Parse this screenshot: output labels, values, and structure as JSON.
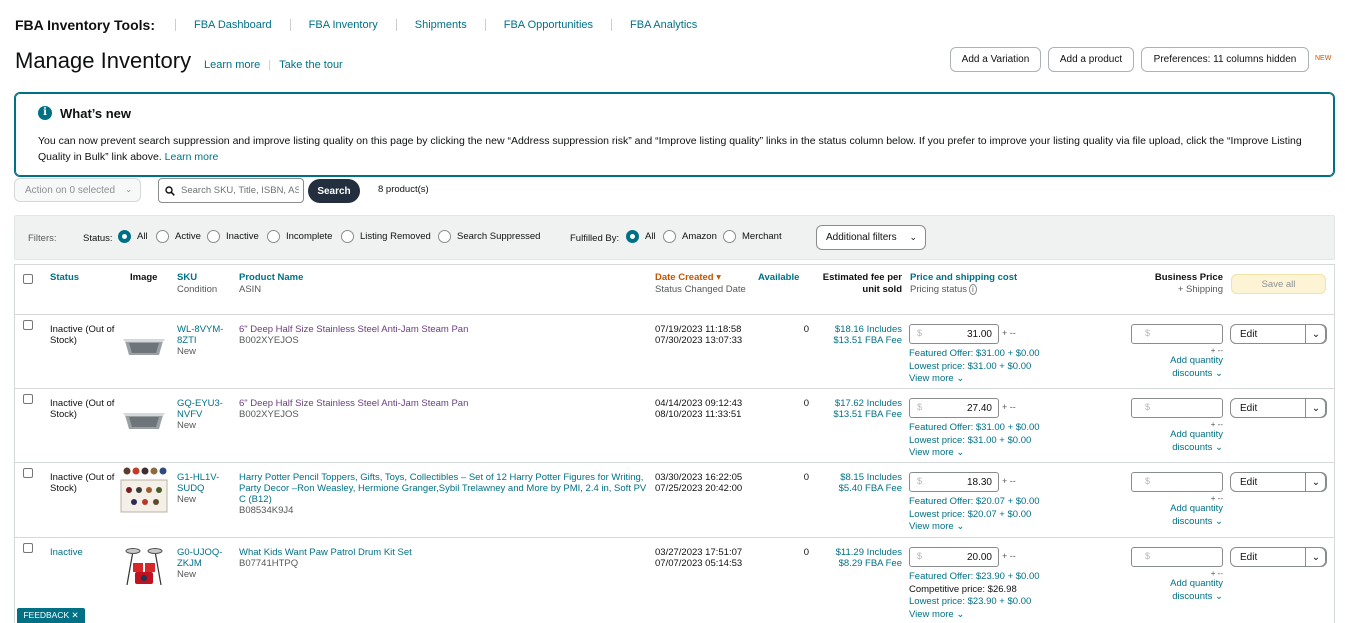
{
  "topnav": {
    "title": "FBA Inventory Tools:",
    "items": [
      "FBA Dashboard",
      "FBA Inventory",
      "Shipments",
      "FBA Opportunities",
      "FBA Analytics"
    ]
  },
  "header": {
    "title": "Manage Inventory",
    "learn_more": "Learn more",
    "take_tour": "Take the tour",
    "add_variation": "Add a Variation",
    "add_product": "Add a product",
    "preferences": "Preferences: 11 columns hidden",
    "new_tag": "NEW"
  },
  "whats_new": {
    "title": "What’s new",
    "body": "You can now prevent search suppression and improve listing quality on this page by clicking the new “Address suppression risk” and “Improve listing quality” links in the status column below. If you prefer to improve your listing quality via file upload, click the “Improve Listing Quality in Bulk” link above.",
    "learn_more": "Learn more"
  },
  "actions": {
    "action_select": "Action on 0 selected",
    "search_placeholder": "Search SKU, Title, ISBN, ASIN",
    "search_button": "Search",
    "product_count": "8 product(s)"
  },
  "filters": {
    "label": "Filters:",
    "status_label": "Status:",
    "status_options": [
      "All",
      "Active",
      "Inactive",
      "Incomplete",
      "Listing Removed",
      "Search Suppressed"
    ],
    "status_selected": "All",
    "fulfilled_label": "Fulfilled By:",
    "fulfilled_options": [
      "All",
      "Amazon",
      "Merchant"
    ],
    "fulfilled_selected": "All",
    "additional": "Additional filters"
  },
  "table": {
    "headers": {
      "status": "Status",
      "image": "Image",
      "sku": "SKU",
      "condition": "Condition",
      "product_name": "Product Name",
      "asin": "ASIN",
      "date_created": "Date Created",
      "status_changed": "Status Changed Date",
      "available": "Available",
      "fee_line1": "Estimated fee per",
      "fee_line2": "unit sold",
      "price": "Price and shipping cost",
      "pricing_status": "Pricing status",
      "business_price": "Business Price",
      "plus_shipping": "+ Shipping",
      "save_all": "Save all"
    },
    "rows": [
      {
        "status": "Inactive (Out of Stock)",
        "sku": "WL-8VYM-8ZTI",
        "condition": "New",
        "name": "6\" Deep Half Size Stainless Steel Anti-Jam Steam Pan",
        "asin": "B002XYEJOS",
        "date_created": "07/19/2023 11:18:58",
        "status_changed": "07/30/2023 13:07:33",
        "available": "0",
        "fee": "$18.16 Includes $13.51 FBA Fee",
        "currency": "$",
        "price": "31.00",
        "plus_dash": "+ --",
        "featured": "Featured Offer: $31.00 + $0.00",
        "competitive": "",
        "lowest": "Lowest price: $31.00 + $0.00",
        "view_more": "View more",
        "biz_currency": "$",
        "biz_plus": "+ --",
        "qty_discounts": "Add quantity discounts",
        "edit": "Edit"
      },
      {
        "status": "Inactive (Out of Stock)",
        "sku": "GQ-EYU3-NVFV",
        "condition": "New",
        "name": "6\" Deep Half Size Stainless Steel Anti-Jam Steam Pan",
        "asin": "B002XYEJOS",
        "date_created": "04/14/2023 09:12:43",
        "status_changed": "08/10/2023 11:33:51",
        "available": "0",
        "fee": "$17.62 Includes $13.51 FBA Fee",
        "currency": "$",
        "price": "27.40",
        "plus_dash": "+ --",
        "featured": "Featured Offer: $31.00 + $0.00",
        "competitive": "",
        "lowest": "Lowest price: $31.00 + $0.00",
        "view_more": "View more",
        "biz_currency": "$",
        "biz_plus": "+ --",
        "qty_discounts": "Add quantity discounts",
        "edit": "Edit"
      },
      {
        "status": "Inactive (Out of Stock)",
        "sku": "G1-HL1V-SUDQ",
        "condition": "New",
        "name": "Harry Potter Pencil Toppers, Gifts, Toys, Collectibles – Set of 12 Harry Potter Figures for Writing, Party Decor –Ron Weasley, Hermione Granger,Sybil Trelawney and More by PMI, 2.4 in, Soft PVC (B12)",
        "asin": "B08534K9J4",
        "date_created": "03/30/2023 16:22:05",
        "status_changed": "07/25/2023 20:42:00",
        "available": "0",
        "fee": "$8.15 Includes $5.40 FBA Fee",
        "currency": "$",
        "price": "18.30",
        "plus_dash": "+ --",
        "featured": "Featured Offer: $20.07 + $0.00",
        "competitive": "",
        "lowest": "Lowest price: $20.07 + $0.00",
        "view_more": "View more",
        "biz_currency": "$",
        "biz_plus": "+ --",
        "qty_discounts": "Add quantity discounts",
        "edit": "Edit"
      },
      {
        "status": "Inactive",
        "sku": "G0-UJOQ-ZKJM",
        "condition": "New",
        "name": "What Kids Want Paw Patrol Drum Kit Set",
        "asin": "B07741HTPQ",
        "date_created": "03/27/2023 17:51:07",
        "status_changed": "07/07/2023 05:14:53",
        "available": "0",
        "fee": "$11.29 Includes $8.29 FBA Fee",
        "currency": "$",
        "price": "20.00",
        "plus_dash": "+ --",
        "featured": "Featured Offer: $23.90 + $0.00",
        "competitive": "Competitive price: $26.98",
        "lowest": "Lowest price: $23.90 + $0.00",
        "view_more": "View more",
        "biz_currency": "$",
        "biz_plus": "+ --",
        "qty_discounts": "Add quantity discounts",
        "edit": "Edit"
      }
    ]
  },
  "feedback": "FEEDBACK ✕"
}
